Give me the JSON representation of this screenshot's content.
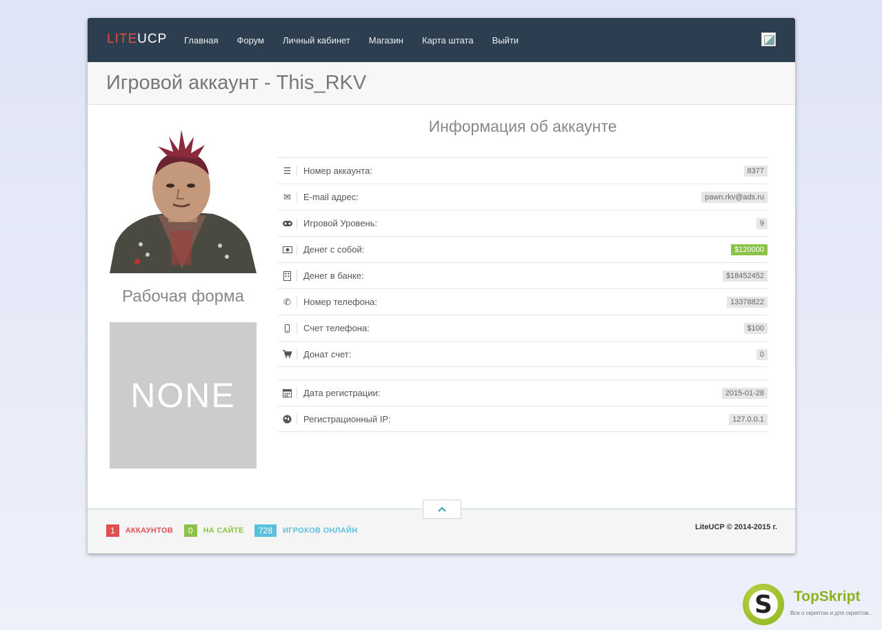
{
  "nav": {
    "brand_lite": "LITE",
    "brand_ucp": "UCP",
    "links": [
      "Главная",
      "Форум",
      "Личный кабинет",
      "Магазин",
      "Карта штата",
      "Выйти"
    ]
  },
  "page": {
    "title": "Игровой аккаунт - This_RKV"
  },
  "left": {
    "form_title": "Рабочая форма",
    "none_text": "NONE"
  },
  "info": {
    "title": "Информация об аккаунте",
    "rows": [
      {
        "icon": "list-icon",
        "label": "Номер аккаунта:",
        "value": "8377"
      },
      {
        "icon": "envelope-icon",
        "label": "E-mail адрес:",
        "value": "pawn.rkv@ads.ru"
      },
      {
        "icon": "gamepad-icon",
        "label": "Игровой Уровень:",
        "value": "9"
      },
      {
        "icon": "money-icon",
        "label": "Денег с собой:",
        "value": "$120000",
        "color": "#8bc34a"
      },
      {
        "icon": "building-icon",
        "label": "Денег в банке:",
        "value": "$18452452"
      },
      {
        "icon": "phone-icon",
        "label": "Номер телефона:",
        "value": "13378822"
      },
      {
        "icon": "mobile-icon",
        "label": "Счет телефона:",
        "value": "$100"
      },
      {
        "icon": "cart-icon",
        "label": "Донат счет:",
        "value": "0"
      },
      {
        "icon": "calendar-icon",
        "label": "Дата регистрации:",
        "value": "2015-01-28"
      },
      {
        "icon": "globe-icon",
        "label": "Регистрационный IP:",
        "value": "127.0.0.1"
      }
    ]
  },
  "footer": {
    "stats": [
      {
        "num": "1",
        "label": "АККАУНТОВ",
        "color": "#e05050"
      },
      {
        "num": "0",
        "label": "НА САЙТЕ",
        "color": "#8bc34a"
      },
      {
        "num": "728",
        "label": "ИГРОКОВ ОНЛАЙН",
        "color": "#5bc0de"
      }
    ],
    "copyright": "LiteUCP © 2014-2015 г."
  },
  "watermark": {
    "logo_letter": "S",
    "name": "TopSkript",
    "subtitle": "Все о скриптах и для скриптов..."
  },
  "colors": {
    "navbar": "#2c3e50",
    "brand_accent": "#e74c3c",
    "money_badge": "#8bc34a"
  }
}
